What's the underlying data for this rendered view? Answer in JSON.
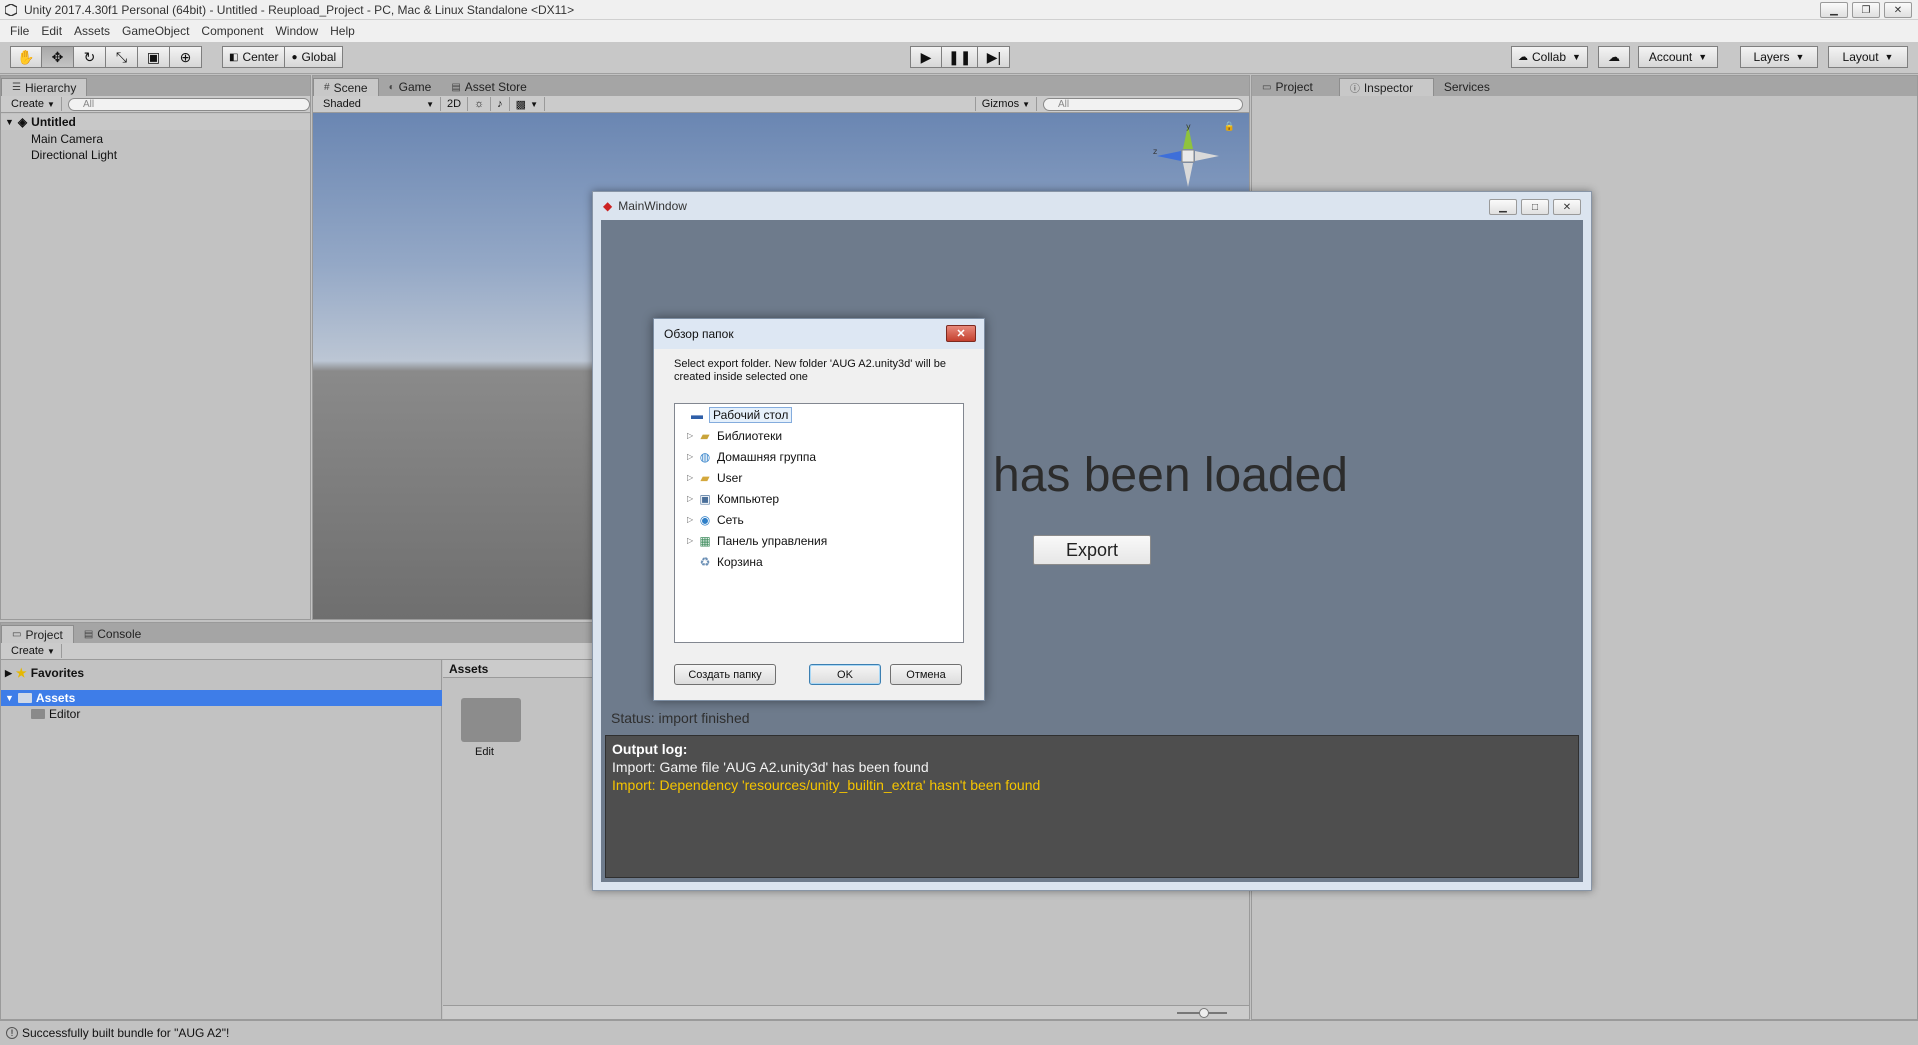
{
  "window": {
    "title": "Unity 2017.4.30f1 Personal (64bit) - Untitled - Reupload_Project - PC, Mac & Linux Standalone <DX11>"
  },
  "menu": [
    "File",
    "Edit",
    "Assets",
    "GameObject",
    "Component",
    "Window",
    "Help"
  ],
  "toolbar": {
    "pivot": "Center",
    "space": "Global",
    "collab": "Collab",
    "account": "Account",
    "layers": "Layers",
    "layout": "Layout"
  },
  "hierarchy": {
    "tab": "Hierarchy",
    "create": "Create",
    "search_placeholder": "All",
    "scene": "Untitled",
    "items": [
      "Main Camera",
      "Directional Light"
    ]
  },
  "scene": {
    "tabs": [
      "Scene",
      "Game",
      "Asset Store"
    ],
    "shading": "Shaded",
    "mode_2d": "2D",
    "gizmos": "Gizmos",
    "search_placeholder": "All"
  },
  "right_panel": {
    "tabs": [
      "Project",
      "Inspector",
      "Services"
    ]
  },
  "project": {
    "tabs": [
      "Project",
      "Console"
    ],
    "create": "Create",
    "favorites": "Favorites",
    "assets": "Assets",
    "editor": "Editor",
    "breadcrumb": "Assets",
    "grid_item": "Edit"
  },
  "statusbar": {
    "message": "Successfully built bundle for \"AUG A2\"!"
  },
  "mainwindow": {
    "title": "MainWindow",
    "loaded_text": "has been loaded",
    "export_button": "Export",
    "status": "Status: import finished",
    "log_header": "Output log:",
    "log_lines": [
      "Import: Game file 'AUG A2.unity3d' has been found",
      "Import: Dependency 'resources/unity_builtin_extra' hasn't been found"
    ]
  },
  "browse_dialog": {
    "title": "Обзор папок",
    "description": "Select export folder. New folder 'AUG A2.unity3d' will be created inside selected one",
    "tree": [
      {
        "label": "Рабочий стол",
        "icon": "desktop-icon"
      },
      {
        "label": "Библиотеки",
        "icon": "library-icon"
      },
      {
        "label": "Домашняя группа",
        "icon": "homegroup-icon"
      },
      {
        "label": "User",
        "icon": "user-folder-icon"
      },
      {
        "label": "Компьютер",
        "icon": "computer-icon"
      },
      {
        "label": "Сеть",
        "icon": "network-icon"
      },
      {
        "label": "Панель управления",
        "icon": "control-panel-icon"
      },
      {
        "label": "Корзина",
        "icon": "recycle-bin-icon"
      }
    ],
    "new_folder_button": "Создать папку",
    "ok_button": "OK",
    "cancel_button": "Отмена"
  }
}
